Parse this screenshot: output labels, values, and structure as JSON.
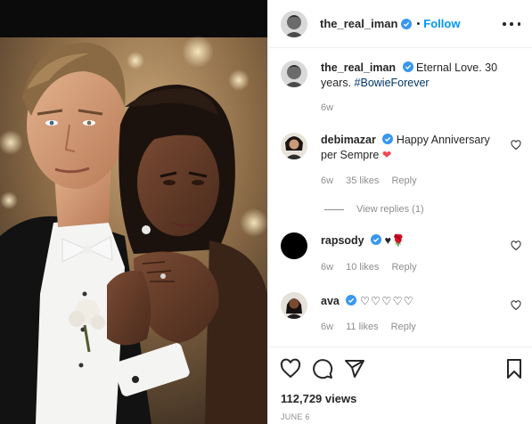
{
  "post": {
    "author": "the_real_iman",
    "follow_label": "Follow",
    "separator": "•",
    "caption_text": "Eternal Love. 30 years.",
    "caption_hashtag": "#BowieForever",
    "caption_age": "6w",
    "views": "112,729 views",
    "date": "JUNE 6"
  },
  "comments": [
    {
      "user": "debimazar",
      "text": "Happy Anniversary per Sempre",
      "emoji": "❤",
      "age": "6w",
      "likes": "35 likes",
      "reply_label": "Reply",
      "view_replies": "View replies (1)"
    },
    {
      "user": "rapsody",
      "text": "",
      "emoji": "♥🌹",
      "age": "6w",
      "likes": "10 likes",
      "reply_label": "Reply"
    },
    {
      "user": "ava",
      "text": "",
      "emoji": "♡♡♡♡♡",
      "age": "6w",
      "likes": "11 likes",
      "reply_label": "Reply"
    }
  ],
  "icons": {
    "verified": "verified-badge-icon",
    "more": "more-options-icon",
    "heart": "heart-icon",
    "comment": "comment-icon",
    "share": "share-icon",
    "save": "bookmark-icon"
  },
  "colors": {
    "accent": "#0095f6",
    "verified": "#3897f0",
    "text": "#262626",
    "muted": "#8e8e8e",
    "hashtag": "#00376b",
    "red_heart": "#ed4956"
  }
}
